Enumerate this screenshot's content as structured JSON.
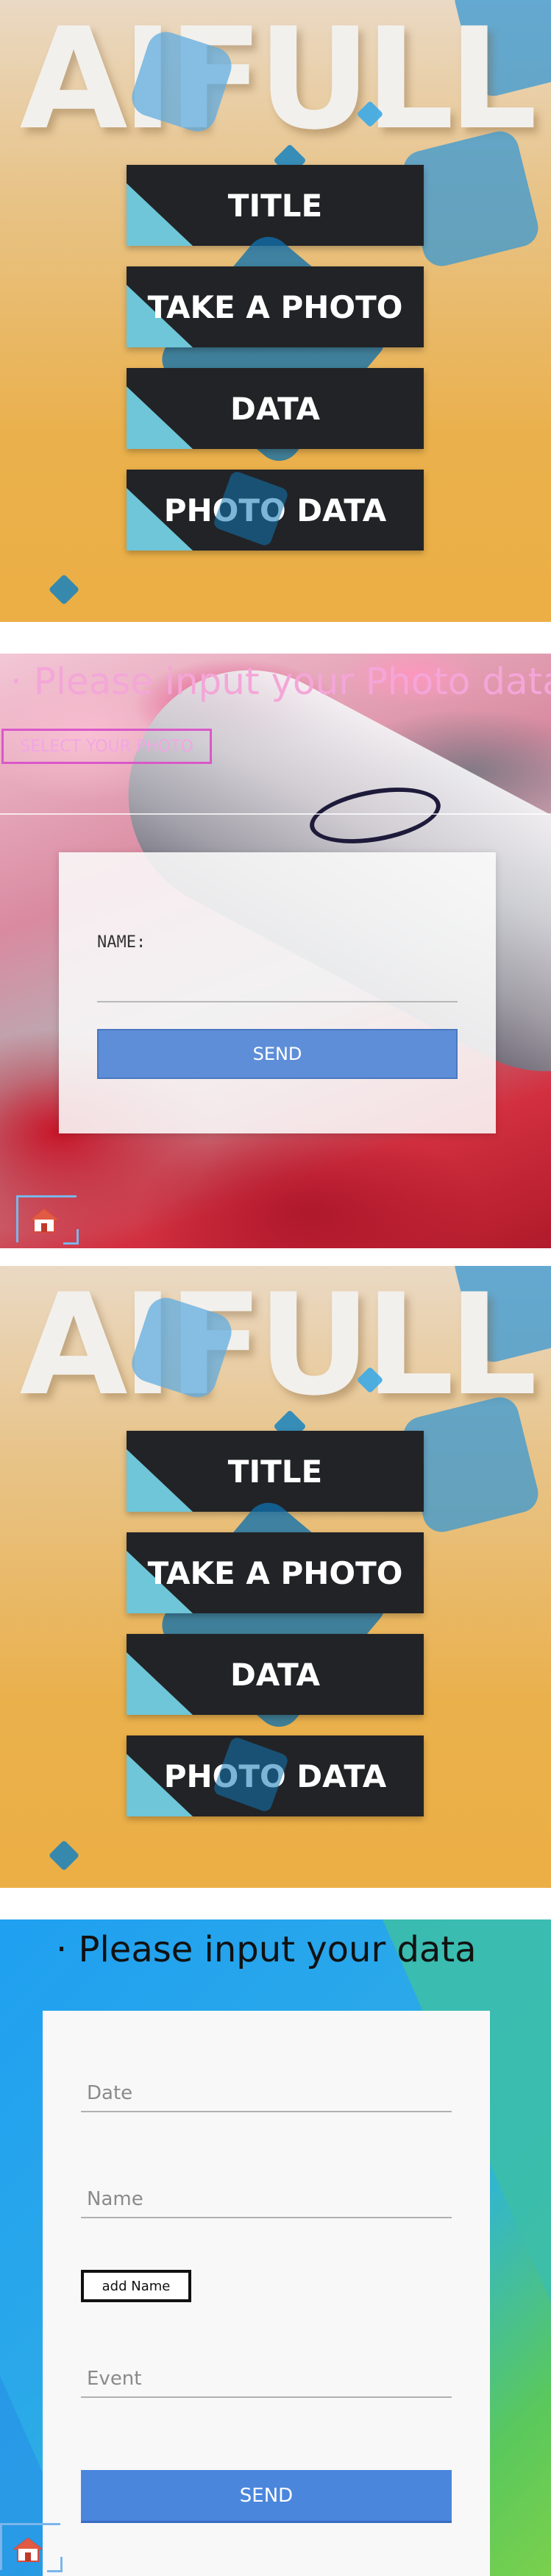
{
  "menu_screen_1": {
    "brand_title": "AIFULL",
    "buttons": [
      {
        "label": "TITLE"
      },
      {
        "label": "TAKE A PHOTO"
      },
      {
        "label": "DATA"
      },
      {
        "label": "PHOTO DATA"
      }
    ]
  },
  "photo_form": {
    "heading": "· Please input your Photo data",
    "select_photo_label": "SELECT YOUR PHOTO",
    "name_label": "NAME:",
    "name_value": "",
    "send_label": "SEND",
    "home_icon": "home-icon"
  },
  "menu_screen_2": {
    "brand_title": "AIFULL",
    "buttons": [
      {
        "label": "TITLE"
      },
      {
        "label": "TAKE A PHOTO"
      },
      {
        "label": "DATA"
      },
      {
        "label": "PHOTO DATA"
      }
    ]
  },
  "data_form": {
    "heading": "· Please input your data",
    "date_placeholder": "Date",
    "name_placeholder": "Name",
    "add_name_label": "add Name",
    "event_placeholder": "Event",
    "send_label": "SEND",
    "home_icon": "home-icon"
  },
  "colors": {
    "menu_button_bg": "#222326",
    "menu_button_accent": "#6ec6d8",
    "photo_heading": "#f4a6d8",
    "photo_send": "#5e8ed8",
    "data_send": "#4a86dc"
  }
}
